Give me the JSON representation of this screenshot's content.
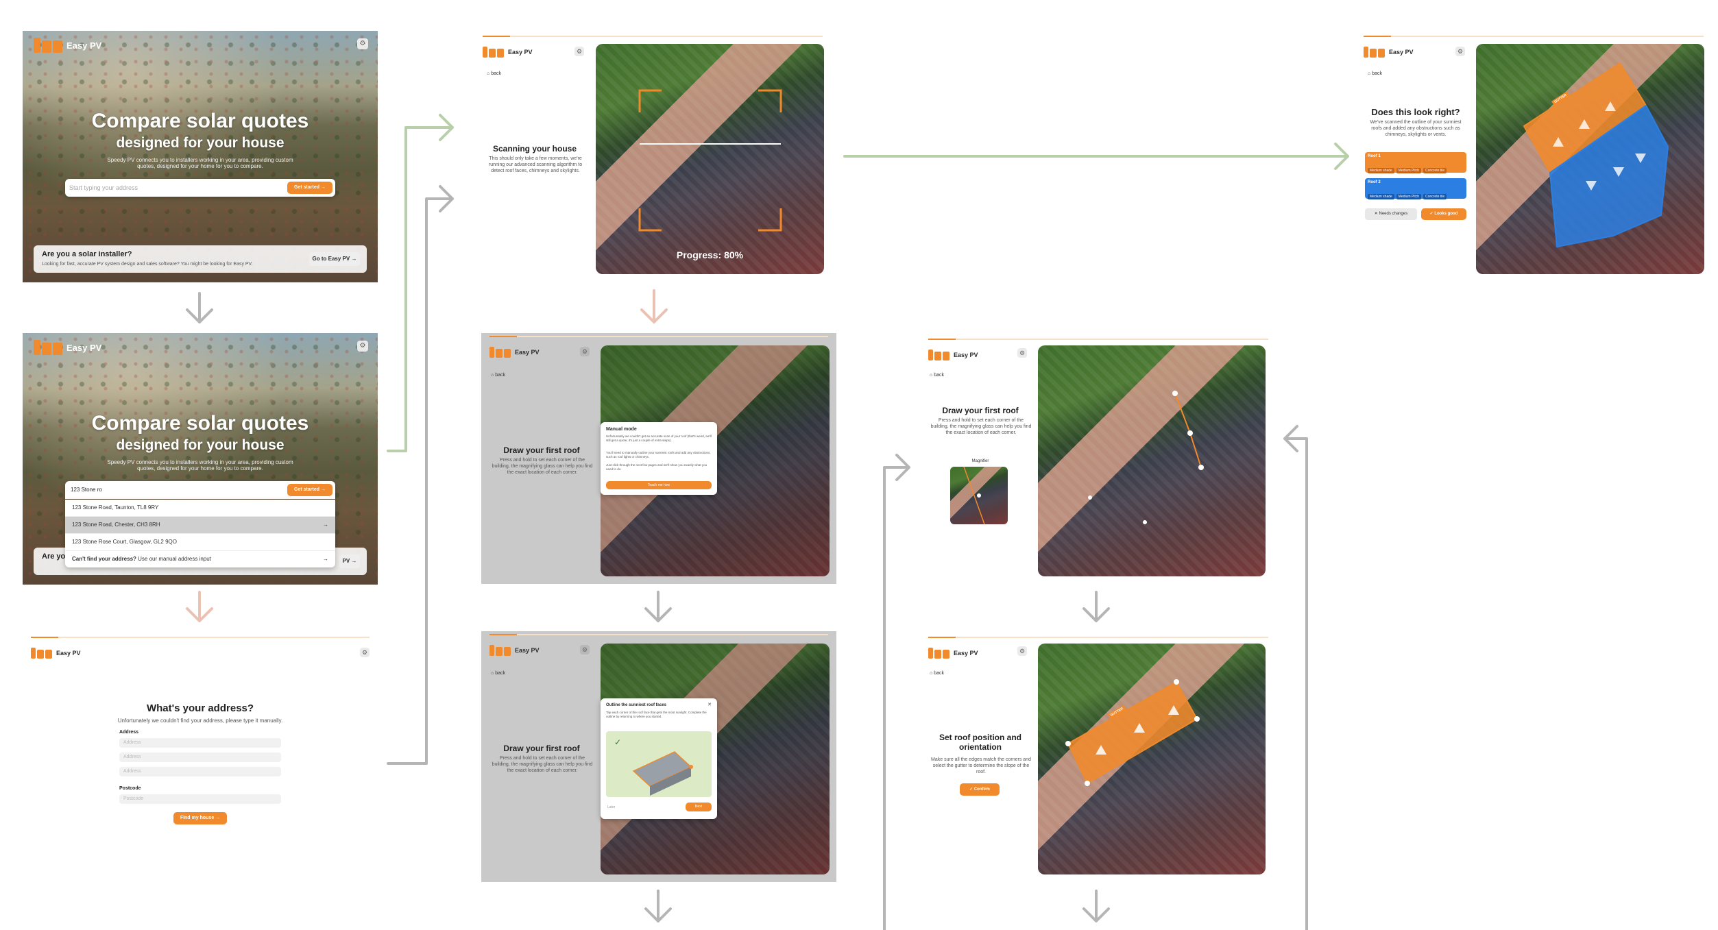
{
  "app": {
    "name": "Easy PV"
  },
  "colors": {
    "accent": "#f08a2c",
    "blue": "#2b7fe3",
    "arrow_green": "#b9cfa9",
    "arrow_pink": "#ebc1b3",
    "arrow_gray": "#b5b5b5"
  },
  "icons": {
    "settings": "gear-icon",
    "back": "home-icon",
    "arrow_right": "arrow-right-icon",
    "check": "check-icon",
    "close": "close-icon"
  },
  "landing": {
    "title_line1": "Compare solar quotes",
    "title_line2": "designed for your house",
    "subtitle": "Speedy PV connects you to installers working in your area, providing custom quotes, designed for your home for you to compare.",
    "search_placeholder": "Start typing your address",
    "cta": "Get started",
    "installer_title": "Are you a solar installer?",
    "installer_desc": "Looking for fast, accurate PV system design and sales software? You might be looking for Easy PV.",
    "installer_button": "Go to Easy PV"
  },
  "autocomplete": {
    "query": "123 Stone ro",
    "cta": "Get started",
    "results": [
      "123 Stone Road, Taunton, TL8 9RY",
      "123 Stone Road, Chester, CH3 8RH",
      "123 Stone Rose Court, Glasgow, GL2 9QO"
    ],
    "cant_find": "Can't find your address?",
    "manual_link": "Use our manual address input",
    "partial_installer": "Are yo",
    "partial_btn": "PV"
  },
  "manual_address": {
    "title": "What's your address?",
    "subtitle": "Unfortunately we couldn't find your address, please type it manually.",
    "address_label": "Address",
    "address_placeholder": "Address",
    "postcode_label": "Postcode",
    "postcode_placeholder": "Postcode",
    "button": "Find my house"
  },
  "scanning": {
    "back": "back",
    "title": "Scanning your house",
    "desc": "This should only take a few moments, we're running our advanced scanning algorithm to detect roof faces, chimneys and skylights.",
    "progress_label": "Progress: 80%",
    "progress": 0.8
  },
  "confirm": {
    "back": "back",
    "title": "Does this look right?",
    "desc": "We've scanned the outline of your sunniest roofs and added any obstructions such as chimneys, skylights or vents.",
    "roof1": {
      "name": "Roof 1",
      "chips": [
        "Medium shade",
        "Medium Pitch",
        "Concrete tile"
      ]
    },
    "roof2": {
      "name": "Roof 2",
      "chips": [
        "Medium shade",
        "Medium Pitch",
        "Concrete tile"
      ]
    },
    "needs_changes": "Needs changes",
    "looks_good": "Looks good",
    "gutter_label": "GUTTER"
  },
  "manual_mode": {
    "back": "back",
    "title": "Draw your first roof",
    "desc": "Press and hold to set each corner of the building, the magnifying glass can help you find the exact location of each corner.",
    "popup_title": "Manual mode",
    "popup_p1": "Unfortunately we couldn't get an accurate scan of your roof (that's weird, we'll still get a quote, it's just a couple of extra steps).",
    "popup_p2": "You'll need to manually outline your sunniest roofs and add any obstructions, such as roof lights or chimneys.",
    "popup_p3": "Just click through the next few pages and we'll show you exactly what you need to do.",
    "popup_button": "Teach me how"
  },
  "outline_tutorial": {
    "back": "back",
    "title": "Draw your first roof",
    "desc": "Press and hold to set each corner of the building, the magnifying glass can help you find the exact location of each corner.",
    "popup_title": "Outline the sunniest roof faces",
    "popup_desc": "Tap each corner of the roof face that gets the most sunlight. Complete the outline by returning to where you started.",
    "later": "Later",
    "next": "Next"
  },
  "draw_roof": {
    "back": "back",
    "title": "Draw your first roof",
    "desc": "Press and hold to set each corner of the building, the magnifying glass can help you find the exact location of each corner.",
    "magnifier": "Magnifier"
  },
  "set_position": {
    "back": "back",
    "title": "Set roof position and orientation",
    "desc": "Make sure all the edges match the corners and select the gutter to determine the slope of the roof.",
    "button": "Confirm",
    "gutter_label": "GUTTER"
  }
}
